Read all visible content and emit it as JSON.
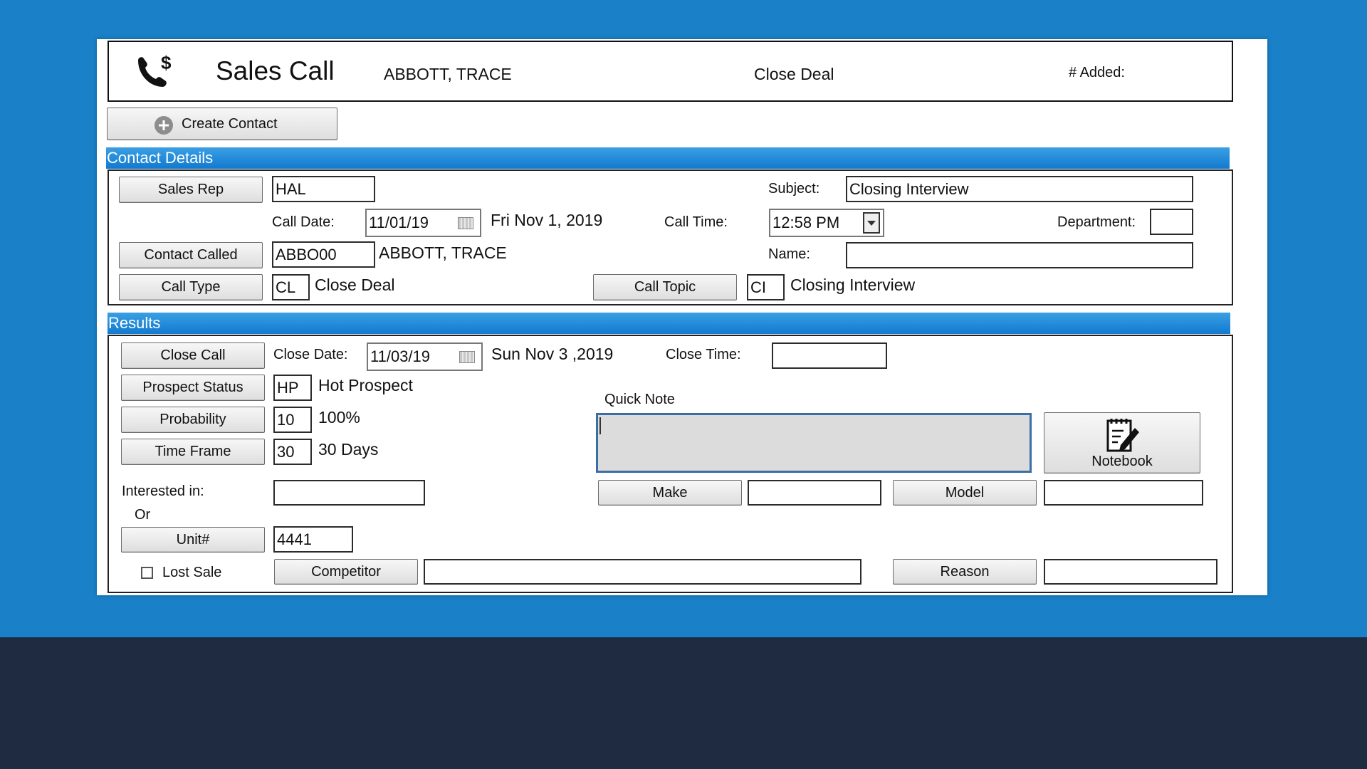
{
  "window": {
    "title": "Sales Call",
    "customer_name": "ABBOTT, TRACE",
    "call_type_title": "Close Deal",
    "added_label": "# Added:"
  },
  "toolbar": {
    "create_contact_label": "Create Contact"
  },
  "contact_details": {
    "section_title": "Contact Details",
    "sales_rep_button": "Sales Rep",
    "sales_rep_value": "HAL",
    "subject_label": "Subject:",
    "subject_value": "Closing Interview",
    "call_date_label": "Call Date:",
    "call_date_value": "11/01/19",
    "call_date_long": "Fri Nov 1, 2019",
    "call_time_label": "Call Time:",
    "call_time_value": "12:58 PM",
    "department_label": "Department:",
    "department_value": "",
    "contact_called_button": "Contact Called",
    "contact_code": "ABBO00",
    "contact_name": "ABBOTT, TRACE",
    "name_label": "Name:",
    "name_value": "",
    "call_type_button": "Call Type",
    "call_type_code": "CL",
    "call_type_desc": "Close Deal",
    "call_topic_button": "Call Topic",
    "call_topic_code": "CI",
    "call_topic_desc": "Closing Interview"
  },
  "results": {
    "section_title": "Results",
    "close_call_button": "Close Call",
    "close_date_label": "Close Date:",
    "close_date_value": "11/03/19",
    "close_date_long": "Sun Nov 3 ,2019",
    "close_time_label": "Close Time:",
    "close_time_value": "",
    "prospect_status_button": "Prospect Status",
    "prospect_code": "HP",
    "prospect_desc": "Hot Prospect",
    "quick_note_label": "Quick Note",
    "quick_note_value": "",
    "notebook_label": "Notebook",
    "probability_button": "Probability",
    "probability_code": "10",
    "probability_desc": "100%",
    "time_frame_button": "Time Frame",
    "time_frame_code": "30",
    "time_frame_desc": "30 Days",
    "interested_label": "Interested in:",
    "interested_value": "",
    "or_label": "Or",
    "make_button": "Make",
    "make_value": "",
    "model_button": "Model",
    "model_value": "",
    "unit_button": "Unit#",
    "unit_value": "4441",
    "lost_sale_label": "Lost Sale",
    "lost_sale_checked": false,
    "competitor_button": "Competitor",
    "competitor_value": "",
    "reason_button": "Reason",
    "reason_value": ""
  },
  "icons": {
    "phone_dollar": "phone-dollar-icon",
    "add": "plus-circle-icon",
    "calendar": "calendar-icon",
    "dropdown": "chevron-down-icon",
    "notebook": "notepad-pencil-icon"
  },
  "colors": {
    "background_blue": "#1a80c8",
    "background_dark": "#1f2b40",
    "section_band": "#1a80d6",
    "quick_note_fill": "#dcdcdc"
  }
}
